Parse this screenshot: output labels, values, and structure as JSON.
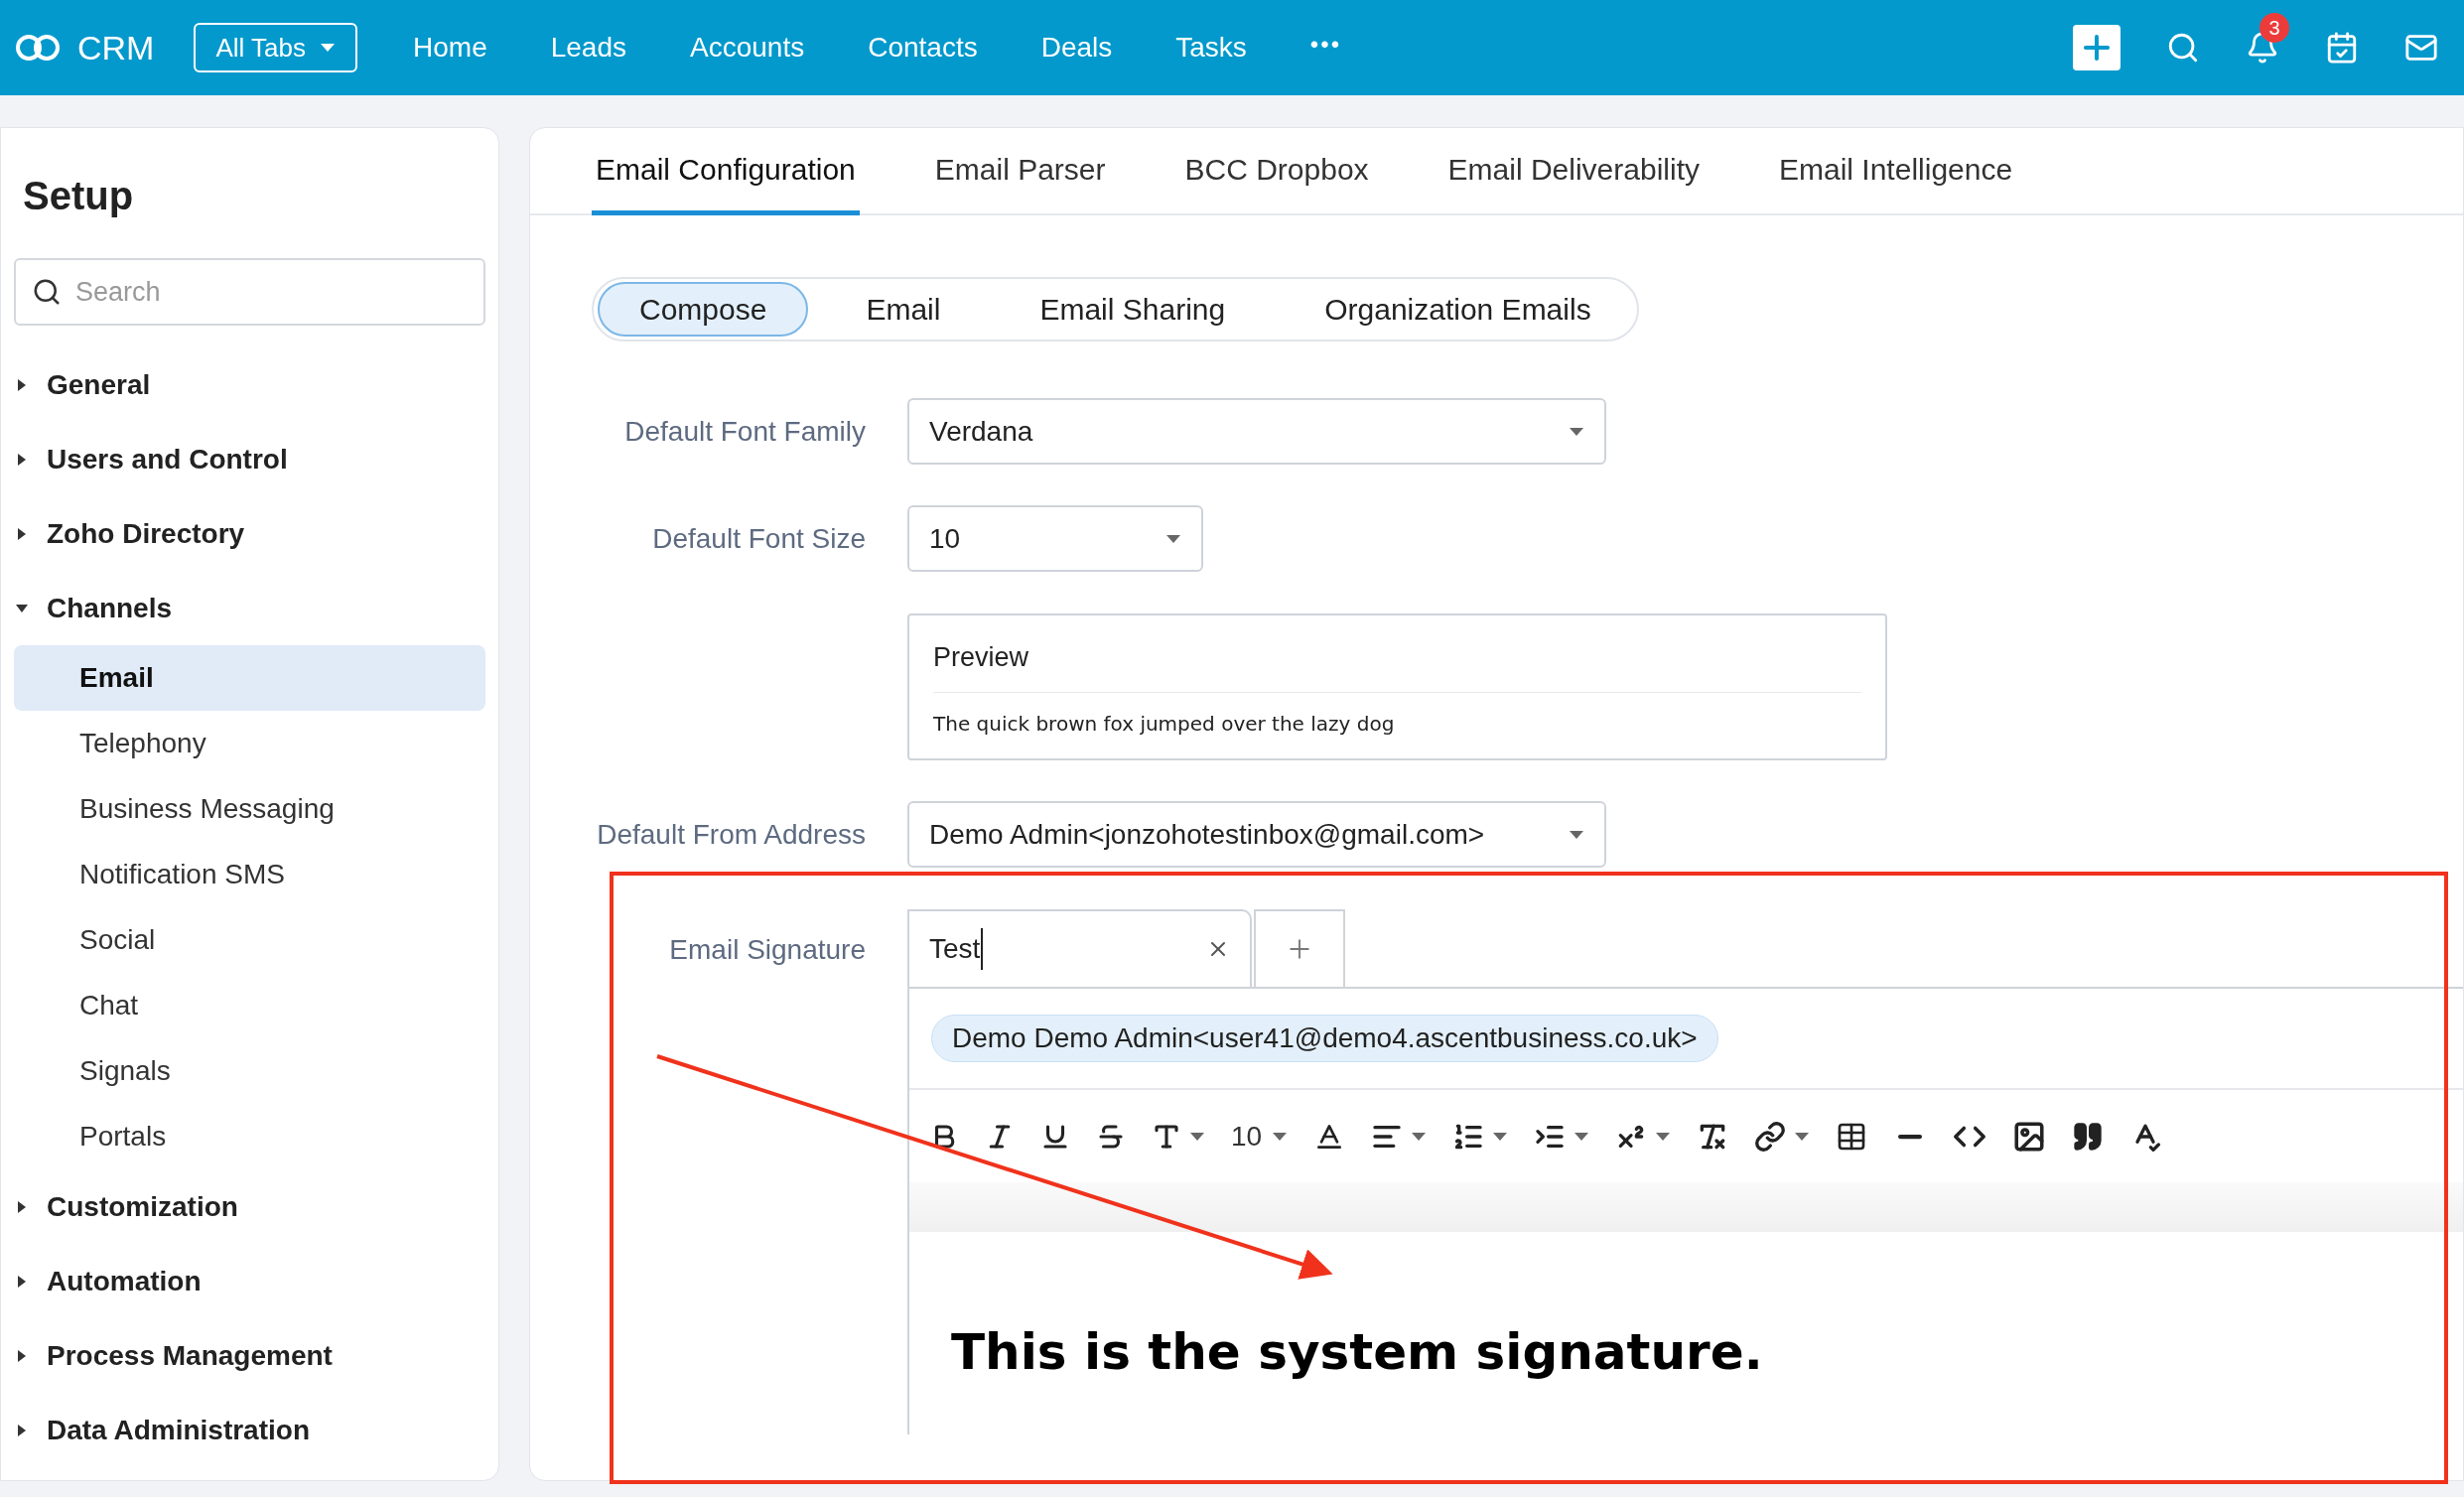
{
  "app": {
    "name": "CRM"
  },
  "topbar": {
    "all_tabs": "All Tabs",
    "nav": [
      "Home",
      "Leads",
      "Accounts",
      "Contacts",
      "Deals",
      "Tasks"
    ],
    "more": "•••",
    "notifications": "3"
  },
  "sidebar": {
    "title": "Setup",
    "search_placeholder": "Search",
    "sections": [
      {
        "label": "General",
        "expanded": false
      },
      {
        "label": "Users and Control",
        "expanded": false
      },
      {
        "label": "Zoho Directory",
        "expanded": false
      },
      {
        "label": "Channels",
        "expanded": true,
        "children": [
          {
            "label": "Email",
            "selected": true
          },
          {
            "label": "Telephony",
            "selected": false
          },
          {
            "label": "Business Messaging",
            "selected": false
          },
          {
            "label": "Notification SMS",
            "selected": false
          },
          {
            "label": "Social",
            "selected": false
          },
          {
            "label": "Chat",
            "selected": false
          },
          {
            "label": "Signals",
            "selected": false
          },
          {
            "label": "Portals",
            "selected": false
          }
        ]
      },
      {
        "label": "Customization",
        "expanded": false
      },
      {
        "label": "Automation",
        "expanded": false
      },
      {
        "label": "Process Management",
        "expanded": false
      },
      {
        "label": "Data Administration",
        "expanded": false
      }
    ]
  },
  "tabs": [
    {
      "label": "Email Configuration",
      "selected": true
    },
    {
      "label": "Email Parser",
      "selected": false
    },
    {
      "label": "BCC Dropbox",
      "selected": false
    },
    {
      "label": "Email Deliverability",
      "selected": false
    },
    {
      "label": "Email Intelligence",
      "selected": false
    }
  ],
  "subtabs": [
    {
      "label": "Compose",
      "selected": true
    },
    {
      "label": "Email",
      "selected": false
    },
    {
      "label": "Email Sharing",
      "selected": false
    },
    {
      "label": "Organization Emails",
      "selected": false
    }
  ],
  "form": {
    "font_family": {
      "label": "Default Font Family",
      "value": "Verdana"
    },
    "font_size": {
      "label": "Default Font Size",
      "value": "10"
    },
    "preview": {
      "title": "Preview",
      "text": "The quick brown fox jumped over the lazy dog"
    },
    "from_address": {
      "label": "Default From Address",
      "value": "Demo Admin<jonzohotestinbox@gmail.com>"
    },
    "signature": {
      "label": "Email Signature",
      "tab": "Test",
      "sender": "Demo Demo Admin<user41@demo4.ascentbusiness.co.uk>",
      "toolbar_font_size": "10",
      "body": "This is the system signature."
    }
  }
}
